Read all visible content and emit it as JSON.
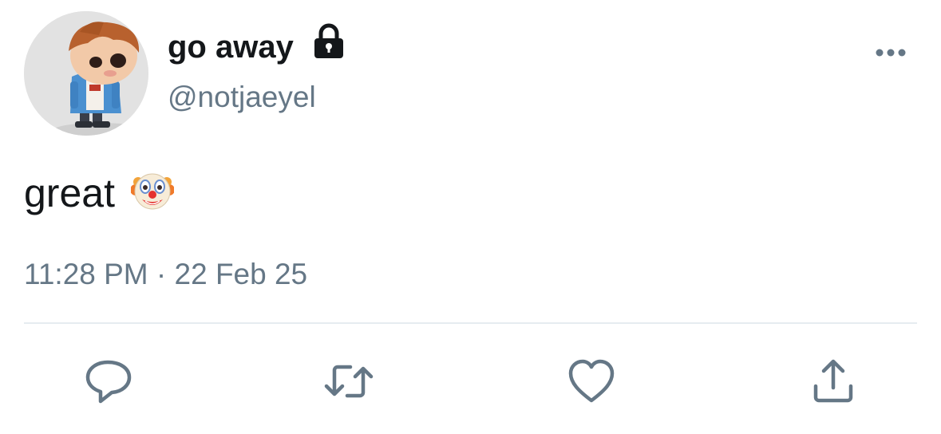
{
  "tweet": {
    "author": {
      "display_name": "go away",
      "handle": "@notjaeyel",
      "protected": true
    },
    "text": "great",
    "emoji": "🤡",
    "timestamp": "11:28 PM · 22 Feb 25"
  },
  "icons": {
    "lock": "lock-icon",
    "more": "more-options-icon",
    "reply": "reply-icon",
    "retweet": "retweet-icon",
    "like": "heart-icon",
    "share": "share-icon"
  },
  "colors": {
    "text_primary": "#14171a",
    "text_secondary": "#657786",
    "icon": "#657786",
    "divider": "#e6ecf0"
  }
}
